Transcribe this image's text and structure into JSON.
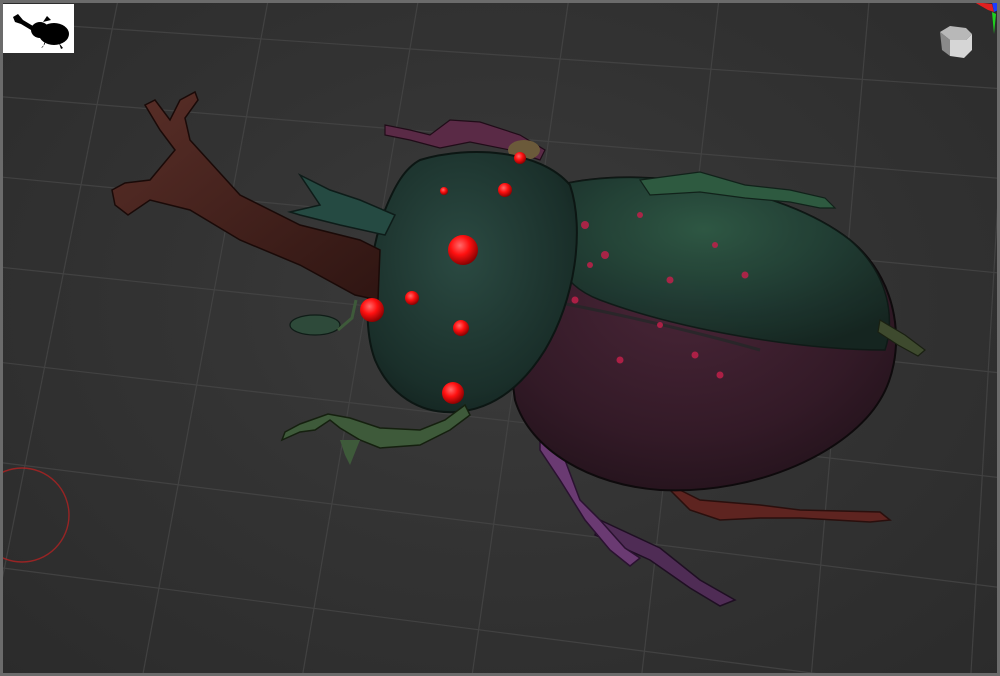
{
  "viewport": {
    "background_color": "#333333",
    "frame_color": "#6b6b6b",
    "grid_color": "#444444"
  },
  "navigator": {
    "thumbnail_icon": "beetle-silhouette-icon",
    "thumbnail_background": "#ffffff"
  },
  "view_cube": {
    "icon": "view-cube-icon",
    "axis_colors": {
      "x": "#e02020",
      "y": "#1fd11f",
      "z": "#1a3cff"
    }
  },
  "rotation_ring": {
    "icon": "rotation-ring-icon",
    "color": "#b22222"
  },
  "model": {
    "subject": "rhinoceros-beetle-sculpt",
    "colors": {
      "horn": "#4a2622",
      "head": "#1f3a33",
      "pronotum": "#1f3a33",
      "elytra_upper": "#2a4a3a",
      "elytra_lower": "#3a2030",
      "eyes": "#ff1a1a",
      "leg_front_left": "#4a5a3a",
      "leg_mid": "#6a3a5a",
      "leg_rear": "#6a2a26",
      "antenna": "#5a2a46"
    }
  }
}
